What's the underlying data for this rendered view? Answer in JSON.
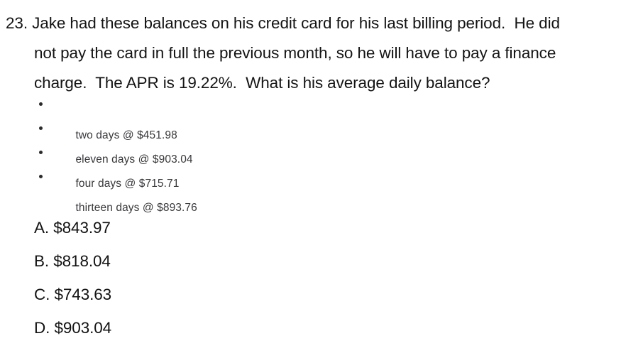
{
  "document": {
    "question_number": "23.",
    "stem_lines": [
      "23. Jake had these balances on his credit card for his last billing period.  He did",
      "not pay the card in full the previous month, so he will have to pay a finance",
      "charge.  The APR is 19.22%.  What is his average daily balance?"
    ],
    "apr": "19.22%",
    "balances": [
      {
        "days": "two days",
        "amount": "$451.98",
        "text": "two days @ $451.98"
      },
      {
        "days": "eleven days",
        "amount": "$903.04",
        "text": "eleven days @ $903.04"
      },
      {
        "days": "four days",
        "amount": "$715.71",
        "text": "four days @ $715.71"
      },
      {
        "days": "thirteen days",
        "amount": "$893.76",
        "text": "thirteen days @ $893.76"
      }
    ],
    "choices": [
      {
        "letter": "A.",
        "value": "$843.97",
        "text": "A. $843.97"
      },
      {
        "letter": "B.",
        "value": "$818.04",
        "text": "B. $818.04"
      },
      {
        "letter": "C.",
        "value": "$743.63",
        "text": "C. $743.63"
      },
      {
        "letter": "D.",
        "value": "$903.04",
        "text": "D. $903.04"
      }
    ]
  }
}
